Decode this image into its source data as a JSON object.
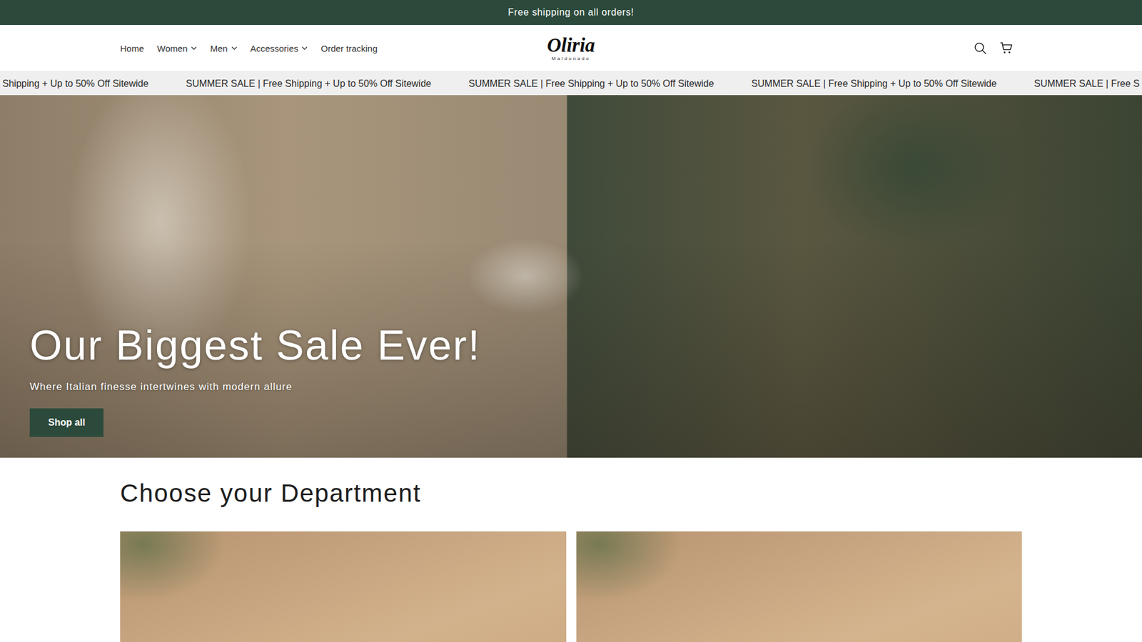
{
  "announcement": "Free shipping on all orders!",
  "header": {
    "nav": [
      {
        "label": "Home",
        "has_menu": false
      },
      {
        "label": "Women",
        "has_menu": true
      },
      {
        "label": "Men",
        "has_menu": true
      },
      {
        "label": "Accessories",
        "has_menu": true
      },
      {
        "label": "Order tracking",
        "has_menu": false
      }
    ],
    "logo": {
      "name": "Oliria",
      "tagline": "Maldonado"
    }
  },
  "marquee": [
    "Shipping + Up to 50% Off Sitewide",
    "SUMMER SALE | Free Shipping + Up to 50% Off Sitewide",
    "SUMMER SALE | Free Shipping + Up to 50% Off Sitewide",
    "SUMMER SALE | Free Shipping + Up to 50% Off Sitewide",
    "SUMMER SALE | Free S"
  ],
  "hero": {
    "title": "Our Biggest Sale Ever!",
    "subtitle": "Where Italian finesse intertwines with modern allure",
    "button": "Shop all"
  },
  "departments": {
    "title": "Choose your Department"
  }
}
